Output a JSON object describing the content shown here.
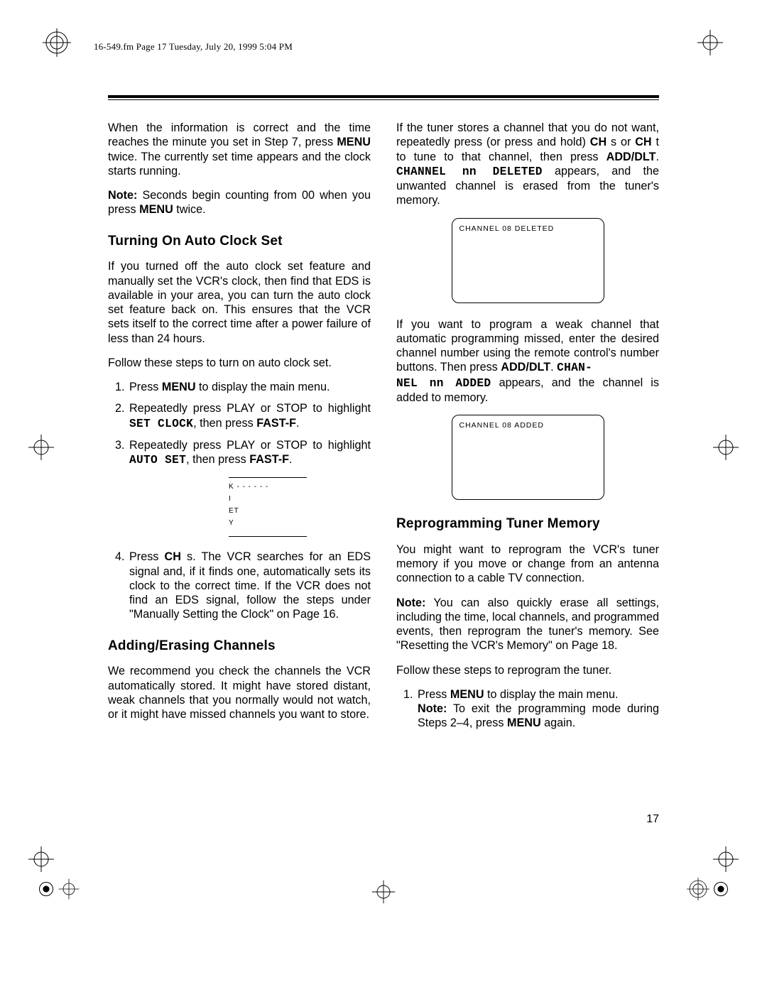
{
  "header": "16-549.fm  Page 17  Tuesday, July 20, 1999  5:04 PM",
  "left": {
    "p1": "When the information is correct and the time reaches the minute you set in Step 7, press MENU twice. The currently set time appears and the clock starts running.",
    "p2_lead": "Note:",
    "p2_body": " Seconds begin counting from 00 when you press MENU twice.",
    "h1": "Turning On Auto Clock Set",
    "p3": "If you turned off the auto clock set feature and manually set the VCR's clock, then find that EDS is available in your area, you can turn the auto clock set feature back on. This ensures that the VCR sets itself to the correct time after a power failure of less than 24 hours.",
    "p4": "Follow these steps to turn on auto clock set.",
    "li1": "Press MENU to display the main menu.",
    "li2a": "Repeatedly press PLAY or STOP to highlight ",
    "li2b": "SET CLOCK",
    "li2c": ", then press FAST-F.",
    "li3a": "Repeatedly press PLAY or STOP to highlight ",
    "li3b": "AUTO SET",
    "li3c": ", then press FAST-F.",
    "mini_rows": [
      "K  - - - - - -",
      "I",
      "ET",
      "",
      "Y"
    ],
    "li4": "Press CH s. The VCR searches for an EDS signal and, if it finds one, automatically sets its clock to the correct time. If the VCR does not find an EDS signal, follow the steps under \"Manually Setting the Clock\" on Page 16.",
    "h2": "Adding/Erasing Channels",
    "p5": "We recommend you check the channels the VCR automatically stored. It might have stored distant, weak channels that you normally would not watch, or it might have missed channels you want to store."
  },
  "right": {
    "p1a": "If the tuner stores a channel that you do not want, repeatedly press (or press and hold) CH s or CH t to tune to that channel, then press ",
    "p1b": "ADD/DLT",
    "p1c": ". ",
    "p1d": "CHANNEL nn DELETED",
    "p1e": " appears, and the unwanted channel is erased from the tuner's memory.",
    "screen1": "CHANNEL  08  DELETED",
    "p2a": "If you want to program a weak channel that automatic programming missed, enter the desired channel number using the remote control's number buttons. Then press ",
    "p2b": "ADD/DLT",
    "p2c": ". ",
    "p2d": "CHAN-\nNEL nn ADDED",
    "p2e": " appears, and the channel is added to memory.",
    "screen2": "CHANNEL  08  ADDED",
    "h1": "Reprogramming Tuner Memory",
    "p3": "You might want to reprogram the VCR's tuner memory if you move or change from an antenna connection to a cable TV connection.",
    "p4_lead": "Note:",
    "p4_body": " You can also quickly erase all settings, including the time, local channels, and programmed events, then reprogram the tuner's memory. See \"Resetting the VCR's Memory\" on Page 18.",
    "p5": "Follow these steps to reprogram the tuner.",
    "li1": "Press MENU to display the main menu.",
    "li1note_lead": "Note:",
    "li1note_body": " To exit the programming mode during Steps 2–4, press MENU again."
  },
  "page_number": "17"
}
